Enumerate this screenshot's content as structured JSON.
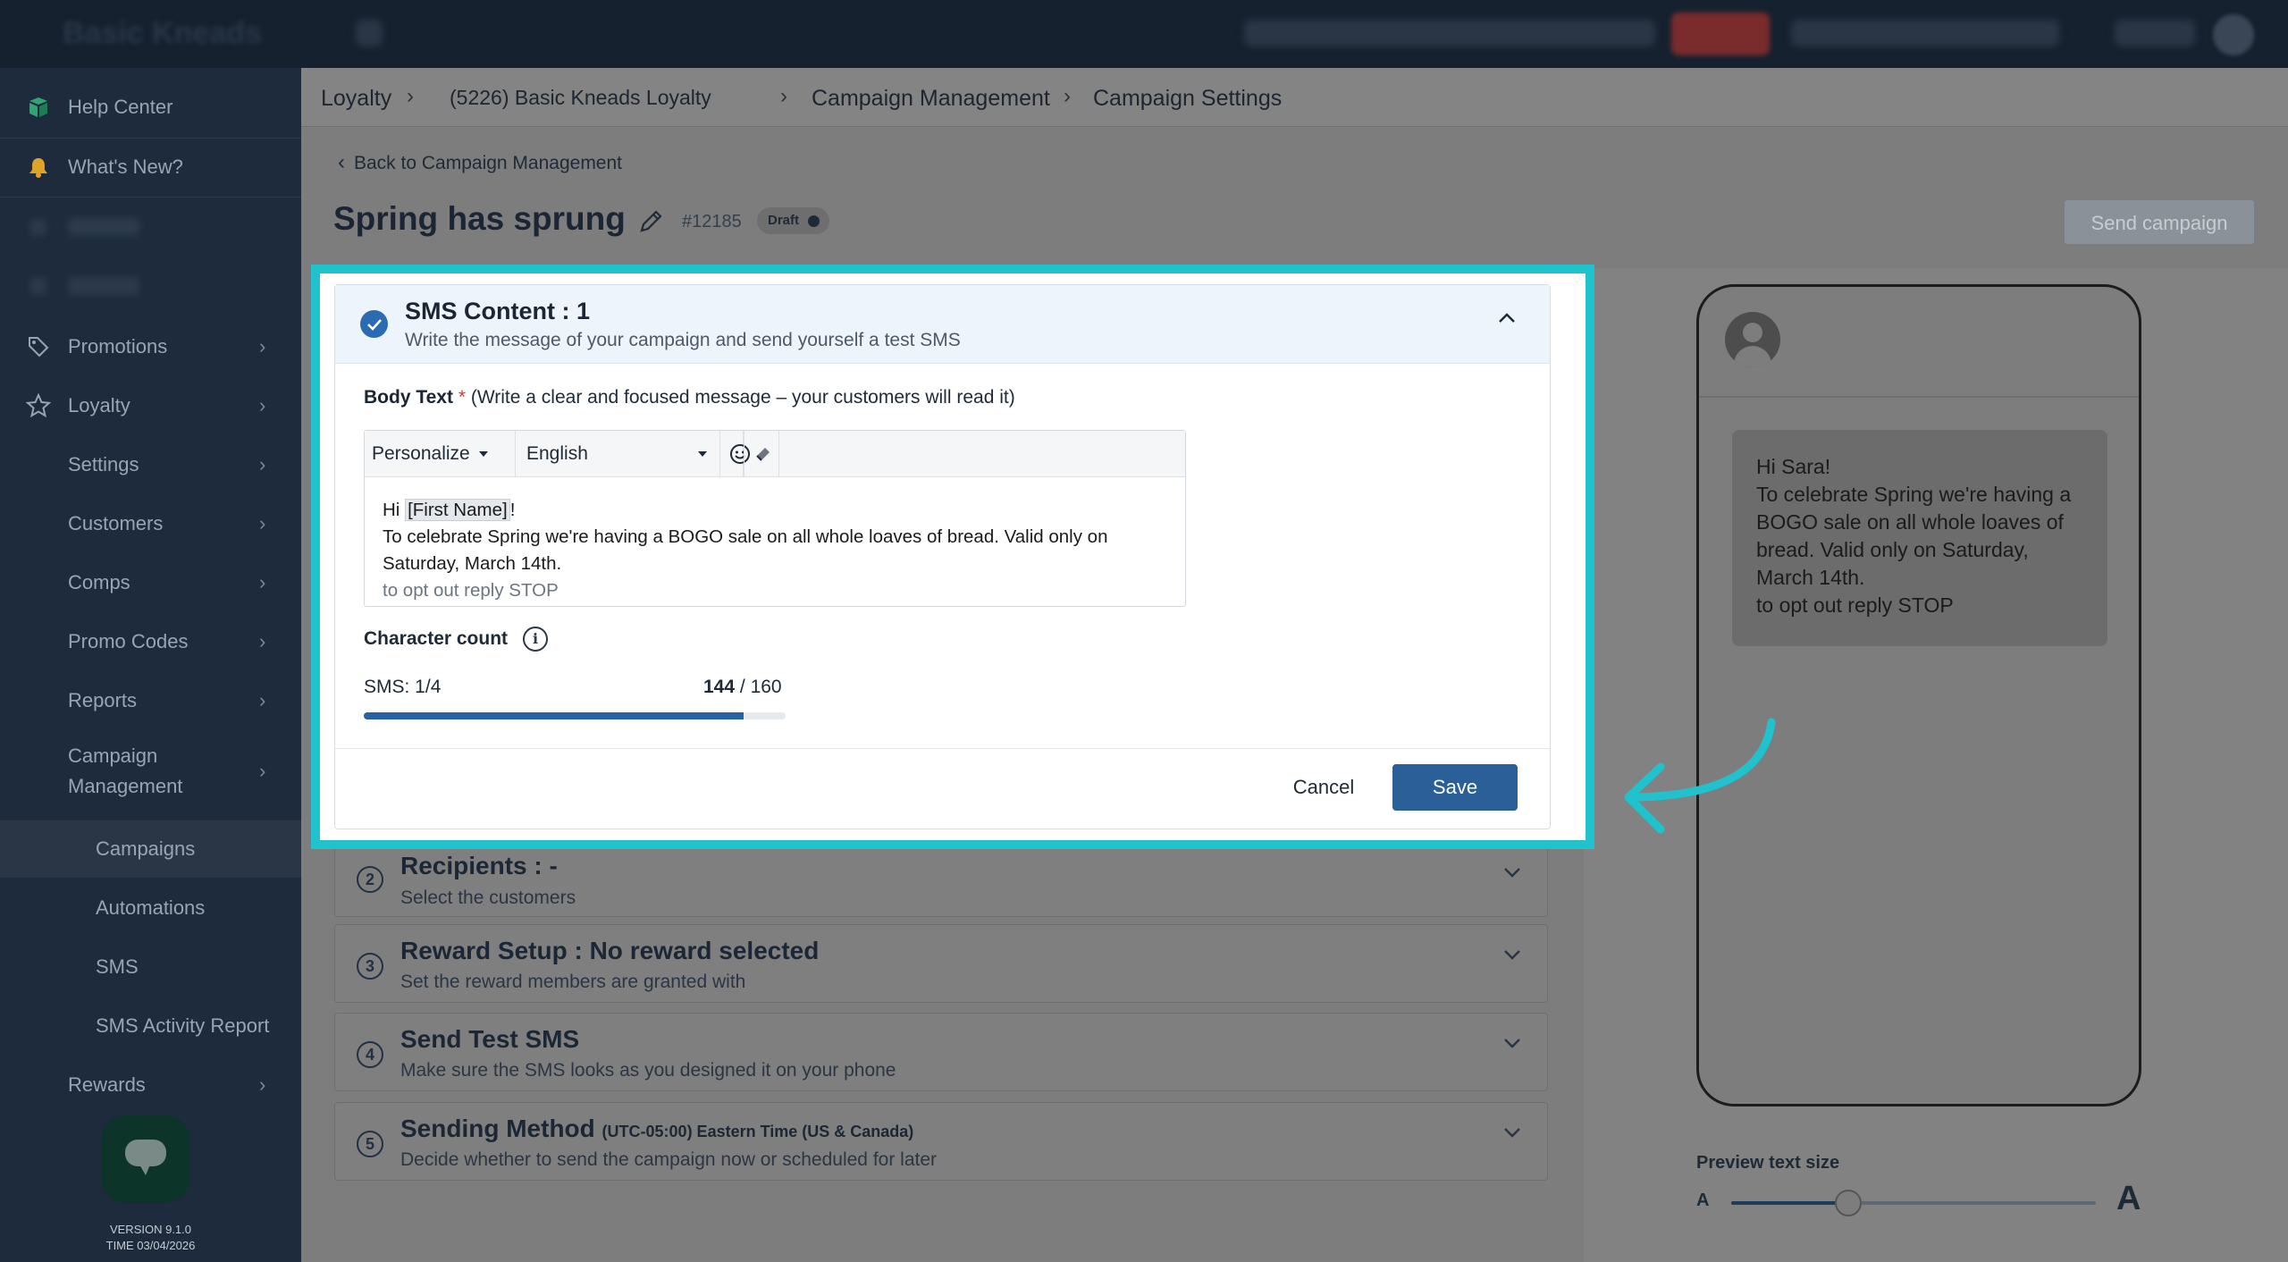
{
  "topbar": {
    "brand": "Basic Kneads"
  },
  "sidebar": {
    "items": [
      {
        "label": "Help Center",
        "icon": "book-icon"
      },
      {
        "label": "What's New?",
        "icon": "bell-icon"
      },
      {
        "label": "Promotions",
        "icon": "tag-icon"
      },
      {
        "label": "Loyalty",
        "icon": "star-icon"
      },
      {
        "label": "Settings"
      },
      {
        "label": "Customers"
      },
      {
        "label": "Comps"
      },
      {
        "label": "Promo Codes"
      },
      {
        "label": "Reports"
      },
      {
        "label": "Campaign\nManagement"
      },
      {
        "label": "Campaigns"
      },
      {
        "label": "Automations"
      },
      {
        "label": "SMS"
      },
      {
        "label": "SMS Activity Report"
      },
      {
        "label": "Rewards"
      }
    ],
    "version": "VERSION 9.1.0",
    "time": "TIME 03/04/2026"
  },
  "breadcrumb": [
    "Loyalty",
    "(5226) Basic Kneads Loyalty",
    "Campaign Management",
    "Campaign Settings"
  ],
  "back_link": "Back to Campaign Management",
  "page": {
    "title": "Spring has sprung",
    "id": "#12185",
    "status": "Draft",
    "send_button": "Send campaign"
  },
  "sms_content": {
    "title": "SMS Content : 1",
    "subtitle": "Write the message of your campaign and send yourself a test SMS",
    "body_label": "Body Text",
    "required_mark": "*",
    "body_hint": "(Write a clear and focused message – your customers will read it)",
    "personalize": "Personalize",
    "language": "English",
    "greeting": "Hi",
    "tag": "[First Name]",
    "exclaim": "!",
    "message_line": "To celebrate Spring we're having a BOGO sale on all whole loaves of bread. Valid only on Saturday, March 14th.",
    "optout": "to opt out reply STOP",
    "char_label": "Character count",
    "sms_count": "SMS: 1/4",
    "chars_used": "144",
    "chars_sep": " / ",
    "chars_limit": "160",
    "progress": 0.9,
    "cancel": "Cancel",
    "save": "Save"
  },
  "sections": [
    {
      "num": "2",
      "title": "Recipients : -",
      "subtitle": "Select the customers"
    },
    {
      "num": "3",
      "title": "Reward Setup : No reward selected",
      "subtitle": "Set the reward members are granted with"
    },
    {
      "num": "4",
      "title": "Send Test SMS",
      "subtitle": "Make sure the SMS looks as you designed it on your phone"
    },
    {
      "num": "5",
      "title": "Sending Method",
      "title_note": "(UTC-05:00) Eastern Time (US & Canada)",
      "subtitle": "Decide whether to send the campaign now or scheduled for later"
    }
  ],
  "preview": {
    "lines": [
      "Hi Sara!",
      "To celebrate Spring we're having a BOGO sale on all whole loaves of bread. Valid only on Saturday, March 14th.",
      "to opt out reply STOP"
    ],
    "label": "Preview text size",
    "small_a": "A",
    "big_a": "A",
    "slider_value": 0.32
  },
  "colors": {
    "highlight": "#20c3cd",
    "primary": "#2a5f98",
    "sidebar": "#1d2b3c"
  }
}
